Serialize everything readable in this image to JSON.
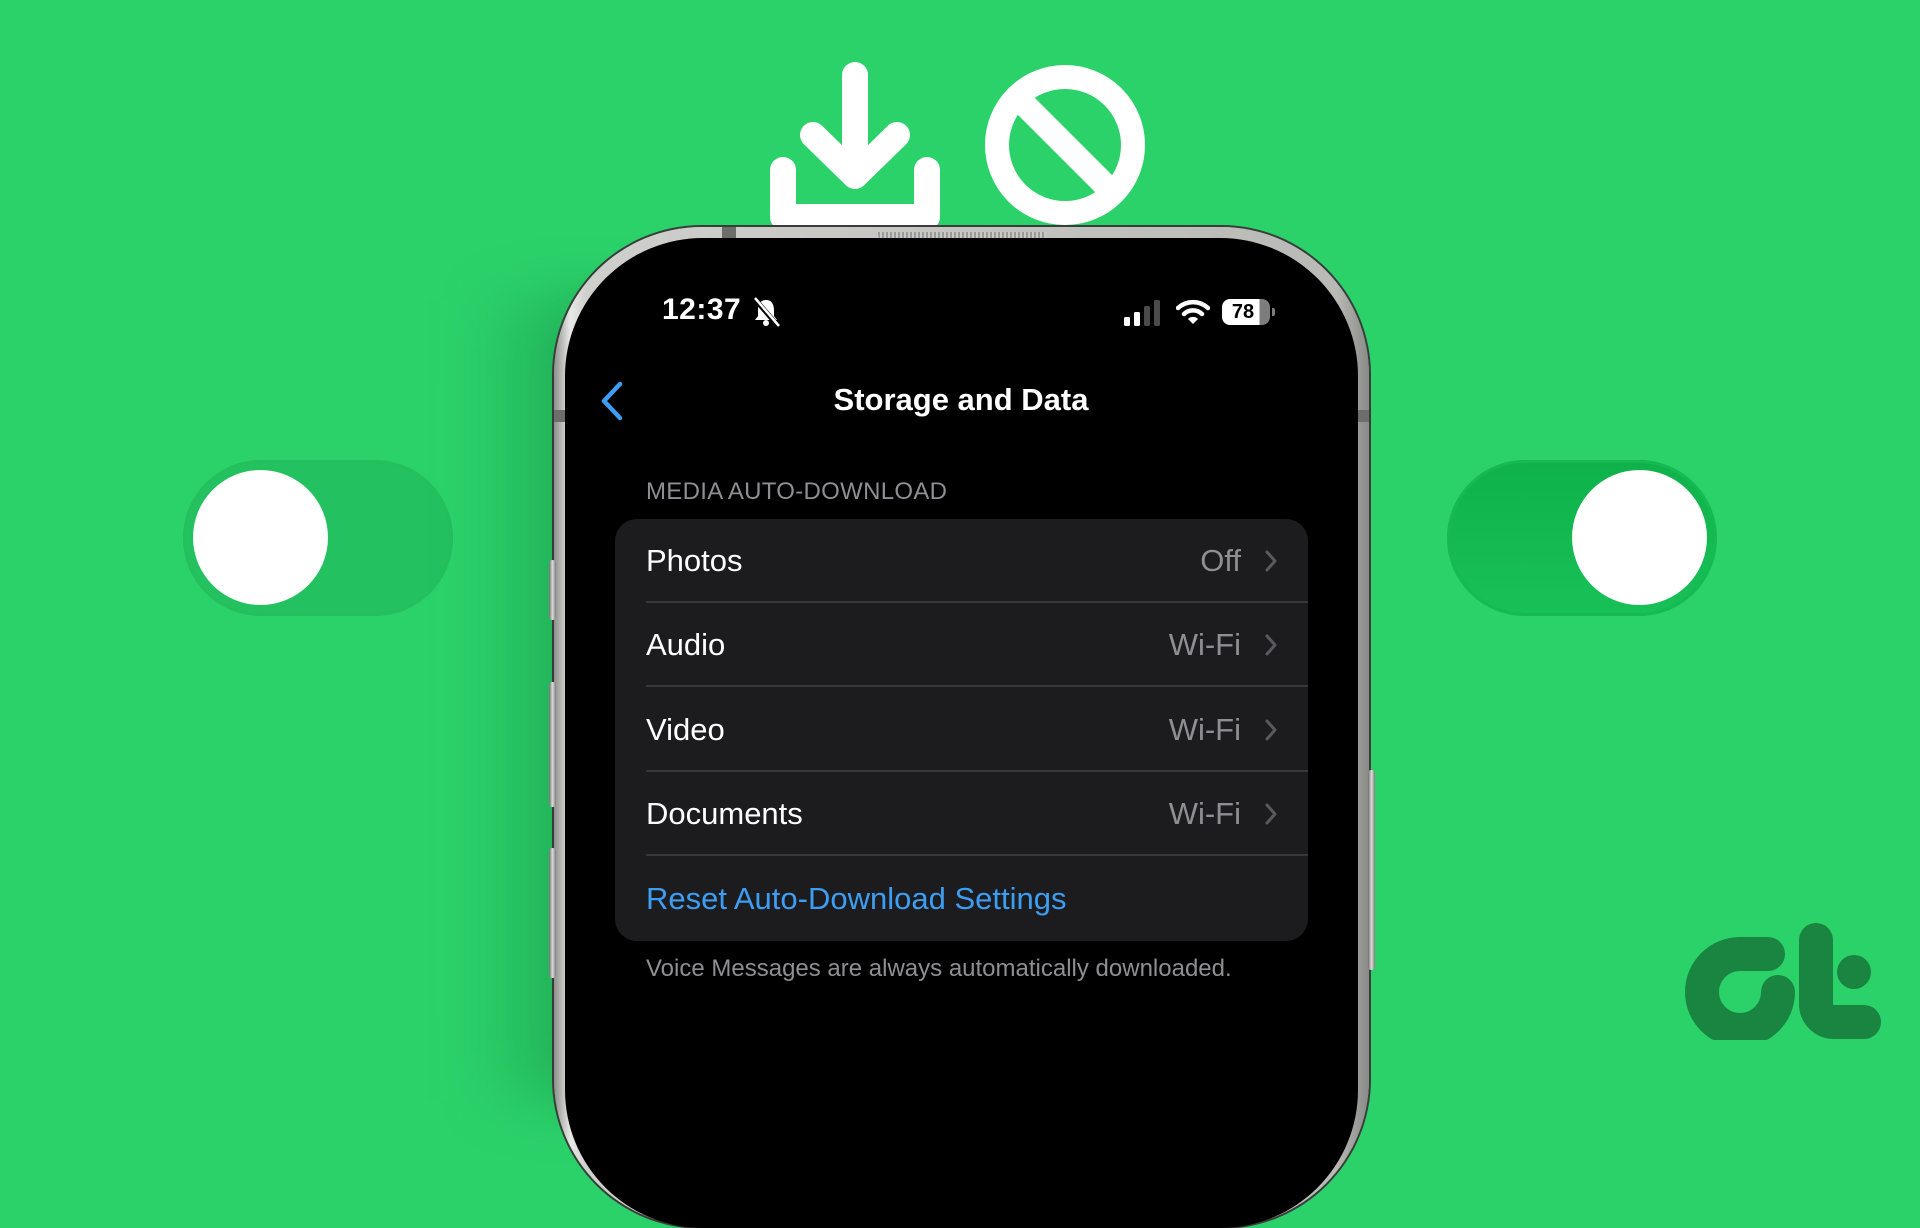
{
  "status_bar": {
    "time": "12:37",
    "silent_icon": "bell-slash-icon",
    "signal_icon": "cellular-signal-icon",
    "signal_bars_active": 2,
    "signal_bars_total": 4,
    "wifi_icon": "wifi-icon",
    "battery_percent": "78"
  },
  "nav": {
    "back_icon": "chevron-left-icon",
    "title": "Storage and Data"
  },
  "section": {
    "header": "MEDIA AUTO-DOWNLOAD",
    "rows": [
      {
        "label": "Photos",
        "value": "Off"
      },
      {
        "label": "Audio",
        "value": "Wi-Fi"
      },
      {
        "label": "Video",
        "value": "Wi-Fi"
      },
      {
        "label": "Documents",
        "value": "Wi-Fi"
      }
    ],
    "reset_label": "Reset Auto-Download Settings",
    "footer": "Voice Messages are always automatically downloaded."
  },
  "decorations": {
    "left_toggle_state": "off",
    "right_toggle_state": "on",
    "top_icons": [
      "download-icon",
      "prohibit-icon"
    ],
    "logo": "GT"
  },
  "colors": {
    "background": "#2bd26a",
    "link_blue": "#3d9df3",
    "list_bg": "#1c1c1e",
    "secondary_text": "#8e8e93",
    "logo_green": "#1a8540"
  }
}
